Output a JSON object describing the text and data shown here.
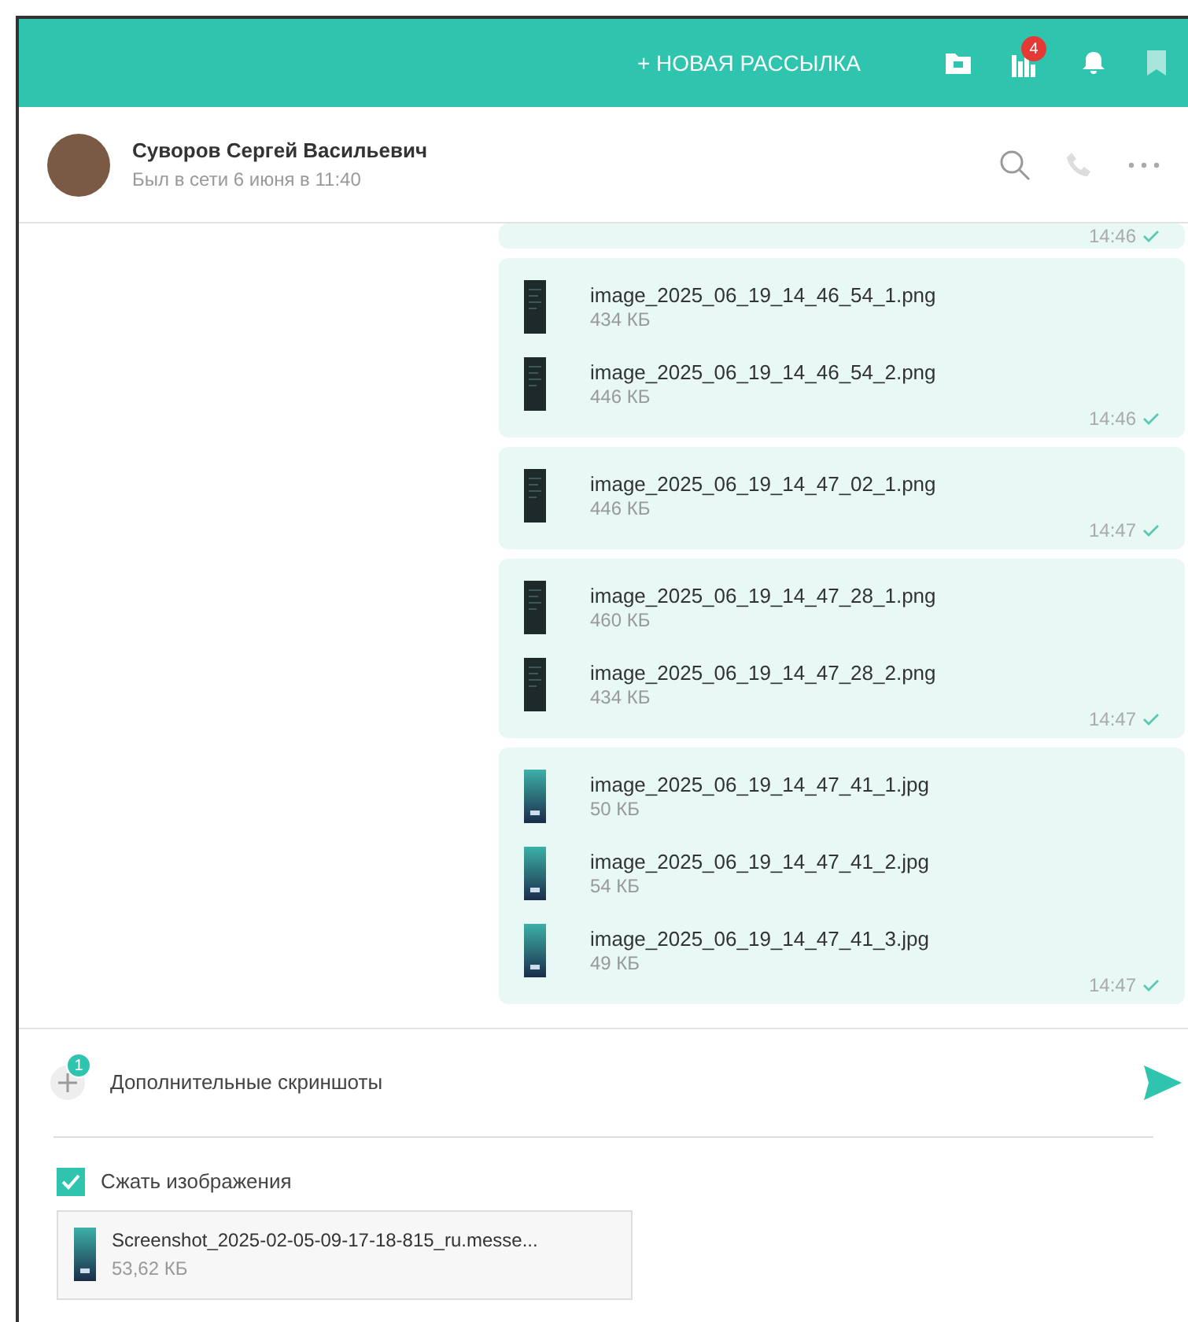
{
  "topbar": {
    "new_mailing": "+ НОВАЯ РАССЫЛКА",
    "badge": "4"
  },
  "contact": {
    "name": "Суворов Сергей Васильевич",
    "status": "Был в сети 6 июня в 11:40"
  },
  "messages": [
    {
      "time": "14:46",
      "delivered": true
    },
    {
      "time": "14:46",
      "delivered": true,
      "files": [
        {
          "name": "image_2025_06_19_14_46_54_1.png",
          "size": "434 КБ",
          "kind": "dark"
        },
        {
          "name": "image_2025_06_19_14_46_54_2.png",
          "size": "446 КБ",
          "kind": "dark"
        }
      ]
    },
    {
      "time": "14:47",
      "delivered": true,
      "files": [
        {
          "name": "image_2025_06_19_14_47_02_1.png",
          "size": "446 КБ",
          "kind": "dark"
        }
      ]
    },
    {
      "time": "14:47",
      "delivered": true,
      "files": [
        {
          "name": "image_2025_06_19_14_47_28_1.png",
          "size": "460 КБ",
          "kind": "dark"
        },
        {
          "name": "image_2025_06_19_14_47_28_2.png",
          "size": "434 КБ",
          "kind": "dark"
        }
      ]
    },
    {
      "time": "14:47",
      "delivered": true,
      "files": [
        {
          "name": "image_2025_06_19_14_47_41_1.jpg",
          "size": "50 КБ",
          "kind": "teal"
        },
        {
          "name": "image_2025_06_19_14_47_41_2.jpg",
          "size": "54 КБ",
          "kind": "teal"
        },
        {
          "name": "image_2025_06_19_14_47_41_3.jpg",
          "size": "49 КБ",
          "kind": "teal"
        }
      ]
    }
  ],
  "composer": {
    "attach_badge": "1",
    "label": "Дополнительные скриншоты"
  },
  "compress": {
    "label": "Сжать изображения",
    "checked": true
  },
  "attachment": {
    "name": "Screenshot_2025-02-05-09-17-18-815_ru.messe...",
    "size": "53,62 КБ",
    "kind": "teal"
  }
}
